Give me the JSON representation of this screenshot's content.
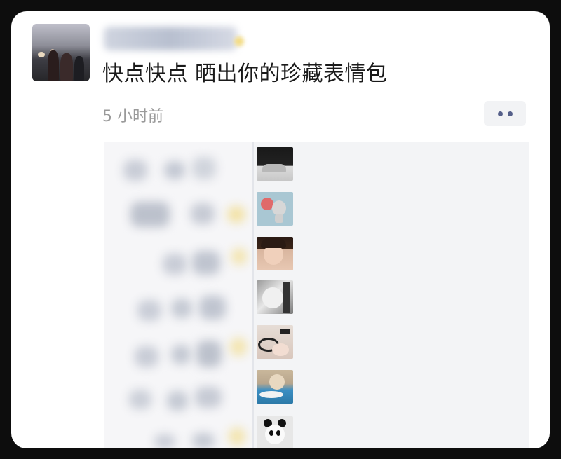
{
  "post": {
    "text": "快点快点 晒出你的珍藏表情包",
    "time": "5 小时前"
  },
  "icons": {
    "more": "more-icon"
  },
  "stickers": [
    "dark-cat-sticker",
    "cartoon-mouse-sticker",
    "girl-sticker",
    "cat-sticker",
    "cat-paws-sticker",
    "dog-in-water-sticker",
    "panda-sticker"
  ]
}
